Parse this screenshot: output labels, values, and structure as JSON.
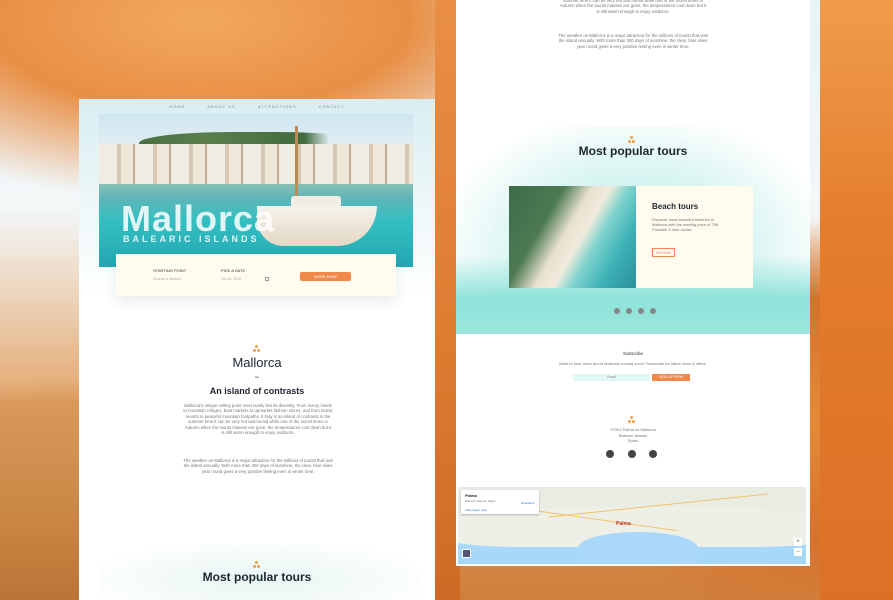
{
  "nav": [
    "HOME",
    "ABOUT US",
    "ATTRACTIONS",
    "CONTACT"
  ],
  "hero": {
    "title": "Mallorca",
    "subtitle": "BALEARIC ISLANDS"
  },
  "booking": {
    "start_label": "STARTING POINT",
    "start_value": "Choose a location",
    "date_label": "PICK A DATE",
    "date_value": "Jan 20, 2020",
    "button": "BOOK NOW"
  },
  "intro": {
    "heading": "Mallorca",
    "divider": "~",
    "subheading": "An island of contrasts",
    "para1": "Mallorca's unique selling point most surely lies its diversity. From luxury hotels to mountain refuges, boat markets to upmarket fashion stores, and from tourist resorts to peaceful mountain footpaths, it truly is an island of contrasts in the summer time it can be very hot and humid while one of the nicest times is Autumn when the tourist masses are gone, the temperatures cool down but it is still warm enough to enjoy outdoors.",
    "para2": "The weather on Mallorca is a major attraction for the millions of tourist that visit the island annually. With more than 300 days of sunshine, the clear, blue skies year round gives a very positive feeling even in winter time."
  },
  "right_top": {
    "para1_tail": "summer time it can be very hot and humid while one of the nicest times is Autumn when the tourist masses are gone, the temperatures cool down but it is still warm enough to enjoy outdoors.",
    "para2": "The weather on Mallorca is a major attraction for the millions of tourist that visit the island annually. With more than 300 days of sunshine, the clear, blue skies year round gives a very positive feeling even in winter time."
  },
  "tours": {
    "heading": "Most popular tours",
    "card_title": "Beach tours",
    "card_text": "Discover most beautiful beaches of Mallorca with the starting price of 75€. Possible 3 hour routes",
    "card_button": "See more",
    "slides": 4
  },
  "subscribe": {
    "title": "Subscribe",
    "text": "Want to hear more about Mallorca coming soon? Subscribe for latest news & offers.",
    "placeholder": "Email",
    "button": "SIGN UP NOW"
  },
  "address": {
    "line1": "07001 Palma de Mallorca",
    "line2": "Balearic Islands",
    "line3": "Spain"
  },
  "map": {
    "place": "Palma",
    "address": "Balearic Islands, Spain",
    "directions": "Directions",
    "view_larger": "View larger map",
    "city_label": "Palma"
  },
  "colors": {
    "accent": "#f08a4b",
    "dark": "#1d2530",
    "teal": "#8fe3da"
  }
}
